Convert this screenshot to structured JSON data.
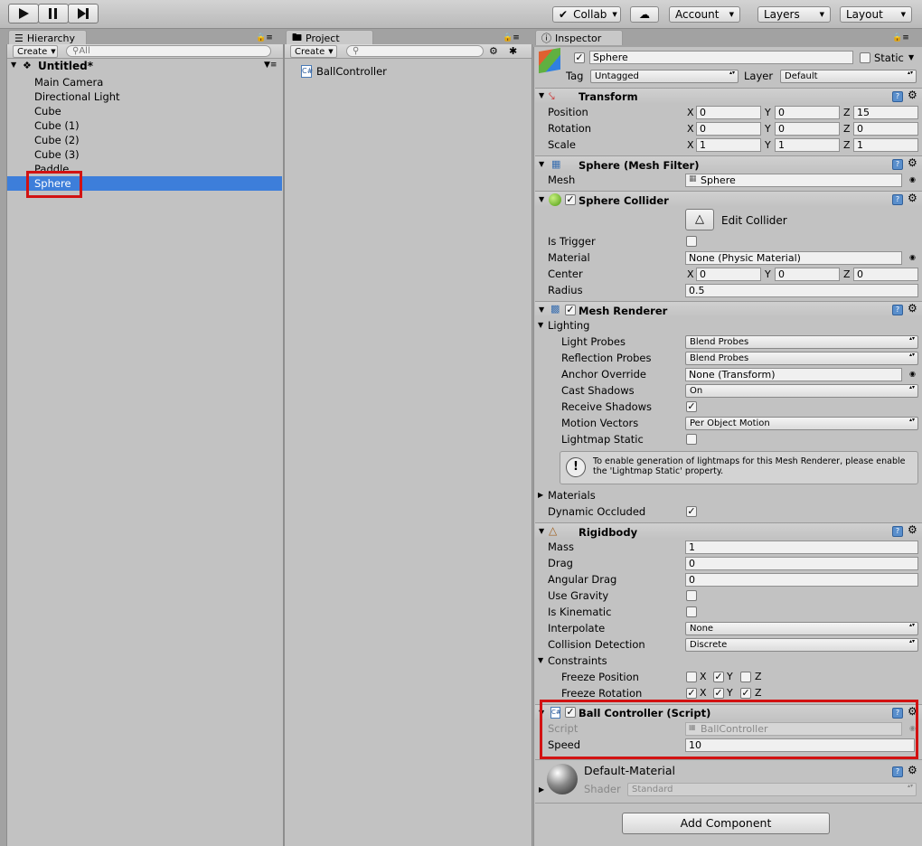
{
  "toolbar": {
    "collab": "Collab",
    "account": "Account",
    "layers": "Layers",
    "layout": "Layout"
  },
  "hierarchy": {
    "tab": "Hierarchy",
    "create": "Create",
    "search": "All",
    "scene": "Untitled*",
    "items": [
      "Main Camera",
      "Directional Light",
      "Cube",
      "Cube (1)",
      "Cube (2)",
      "Cube (3)",
      "Paddle",
      "Sphere"
    ]
  },
  "project": {
    "tab": "Project",
    "create": "Create",
    "asset": "BallController"
  },
  "inspector": {
    "tab": "Inspector",
    "name": "Sphere",
    "static": "Static",
    "tag_label": "Tag",
    "tag": "Untagged",
    "layer_label": "Layer",
    "layer": "Default",
    "transform": {
      "title": "Transform",
      "position": "Position",
      "rotation": "Rotation",
      "scale": "Scale",
      "x": "X",
      "y": "Y",
      "z": "Z",
      "pos": [
        "0",
        "0",
        "15"
      ],
      "rot": [
        "0",
        "0",
        "0"
      ],
      "scl": [
        "1",
        "1",
        "1"
      ]
    },
    "meshfilter": {
      "title": "Sphere (Mesh Filter)",
      "mesh_label": "Mesh",
      "mesh": "Sphere"
    },
    "collider": {
      "title": "Sphere Collider",
      "edit": "Edit Collider",
      "is_trigger": "Is Trigger",
      "material_label": "Material",
      "material": "None (Physic Material)",
      "center": "Center",
      "cx": "0",
      "cy": "0",
      "cz": "0",
      "radius_label": "Radius",
      "radius": "0.5"
    },
    "renderer": {
      "title": "Mesh Renderer",
      "lighting": "Lighting",
      "light_probes": "Light Probes",
      "light_probes_val": "Blend Probes",
      "refl_probes": "Reflection Probes",
      "refl_probes_val": "Blend Probes",
      "anchor": "Anchor Override",
      "anchor_val": "None (Transform)",
      "cast": "Cast Shadows",
      "cast_val": "On",
      "receive": "Receive Shadows",
      "motion": "Motion Vectors",
      "motion_val": "Per Object Motion",
      "lightmap": "Lightmap Static",
      "info": "To enable generation of lightmaps for this Mesh Renderer, please enable the 'Lightmap Static' property.",
      "materials": "Materials",
      "dyn_occ": "Dynamic Occluded"
    },
    "rigidbody": {
      "title": "Rigidbody",
      "mass_label": "Mass",
      "mass": "1",
      "drag_label": "Drag",
      "drag": "0",
      "ang_label": "Angular Drag",
      "ang": "0",
      "gravity": "Use Gravity",
      "kinematic": "Is Kinematic",
      "interp_label": "Interpolate",
      "interp": "None",
      "coll_label": "Collision Detection",
      "coll": "Discrete",
      "constraints": "Constraints",
      "freeze_pos": "Freeze Position",
      "freeze_rot": "Freeze Rotation",
      "x": "X",
      "y": "Y",
      "z": "Z"
    },
    "script": {
      "title": "Ball Controller (Script)",
      "script_label": "Script",
      "script": "BallController",
      "speed_label": "Speed",
      "speed": "10"
    },
    "material": {
      "title": "Default-Material",
      "shader_label": "Shader",
      "shader": "Standard"
    },
    "add_component": "Add Component"
  },
  "colors": {
    "accent": "#3d7eda",
    "highlight": "#d21212"
  }
}
